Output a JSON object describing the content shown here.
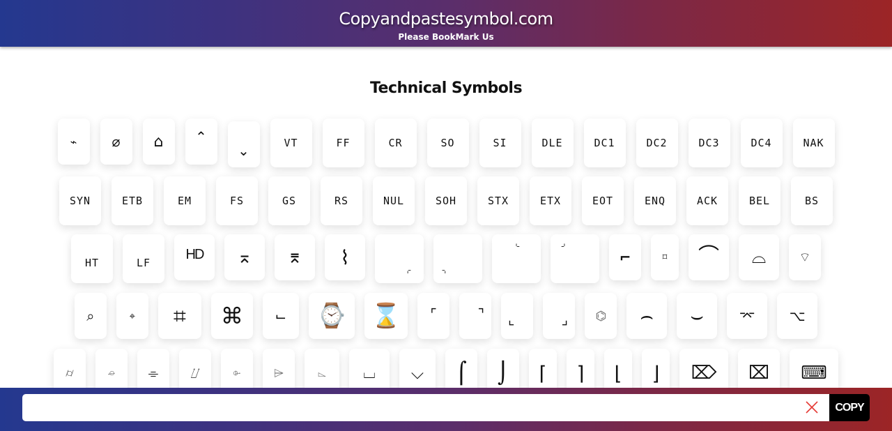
{
  "header": {
    "site_title": "Copyandpastesymbol.com",
    "tagline": "Please BookMark Us"
  },
  "page": {
    "title": "Technical Symbols"
  },
  "symbols": {
    "row1": [
      "⌁",
      "⌀",
      "⌂",
      "⌃",
      "⌄",
      "VT",
      "FF",
      "CR",
      "SO",
      "SI",
      "DLE",
      "DC1",
      "DC2",
      "DC3",
      "DC4",
      "NAK"
    ],
    "row2": [
      "SYN",
      "ETB",
      "EM",
      "FS",
      "GS",
      "RS",
      "NUL",
      "SOH",
      "STX",
      "ETX",
      "EOT",
      "ENQ",
      "ACK",
      "BEL",
      "BS"
    ],
    "row3": [
      "HT",
      "LF",
      "HD",
      "⌅",
      "⌆",
      "⌇",
      "⌌",
      "⌍",
      "⌎",
      "⌏",
      "⌐",
      "⌑",
      "⌒",
      "⌓",
      "⌔"
    ],
    "row4": [
      "⌕",
      "⌖",
      "⌗",
      "⌘",
      "⌙",
      "⌚",
      "⌛",
      "⌜",
      "⌝",
      "⌞",
      "⌟",
      "⌬",
      "⌢",
      "⌣",
      "⌤",
      "⌥"
    ],
    "row5": [
      "⌭",
      "⌮",
      "⌯",
      "⌰",
      "⌱",
      "⌲",
      "⌳",
      "⌴",
      "⌵",
      "⌠",
      "⌡",
      "⌈",
      "⌉",
      "⌊",
      "⌋",
      "⌦",
      "⌧",
      "⌨"
    ]
  },
  "copy_bar": {
    "value": "",
    "placeholder": "",
    "clear_icon": "close-icon",
    "copy_label": "COPY",
    "clear_color": "#e53935"
  },
  "colors": {
    "gradient_start": "#24388f",
    "gradient_end": "#9c2526",
    "copy_button_bg": "#000000"
  }
}
